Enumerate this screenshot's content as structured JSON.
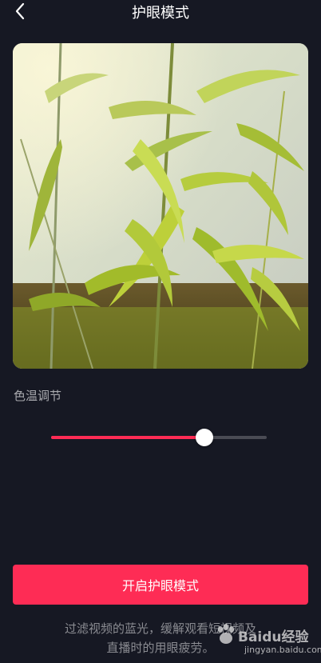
{
  "header": {
    "title": "护眼模式",
    "back_icon": "chevron-left-icon"
  },
  "preview": {
    "description_icon": "bamboo-leaves-photo"
  },
  "color_temperature": {
    "label": "色温调节",
    "value_fraction": 0.71,
    "fill_color": "#fe2c55",
    "track_color": "#4a4b54"
  },
  "actions": {
    "enable_label": "开启护眼模式"
  },
  "description": {
    "line1": "过滤视频的蓝光，缓解观看短视频及",
    "line2": "直播时的用眼疲劳。"
  },
  "watermark": {
    "brand": "Baidu经验",
    "url": "jingyan.baidu.com"
  },
  "colors": {
    "background": "#161823",
    "accent": "#fe2c55"
  }
}
